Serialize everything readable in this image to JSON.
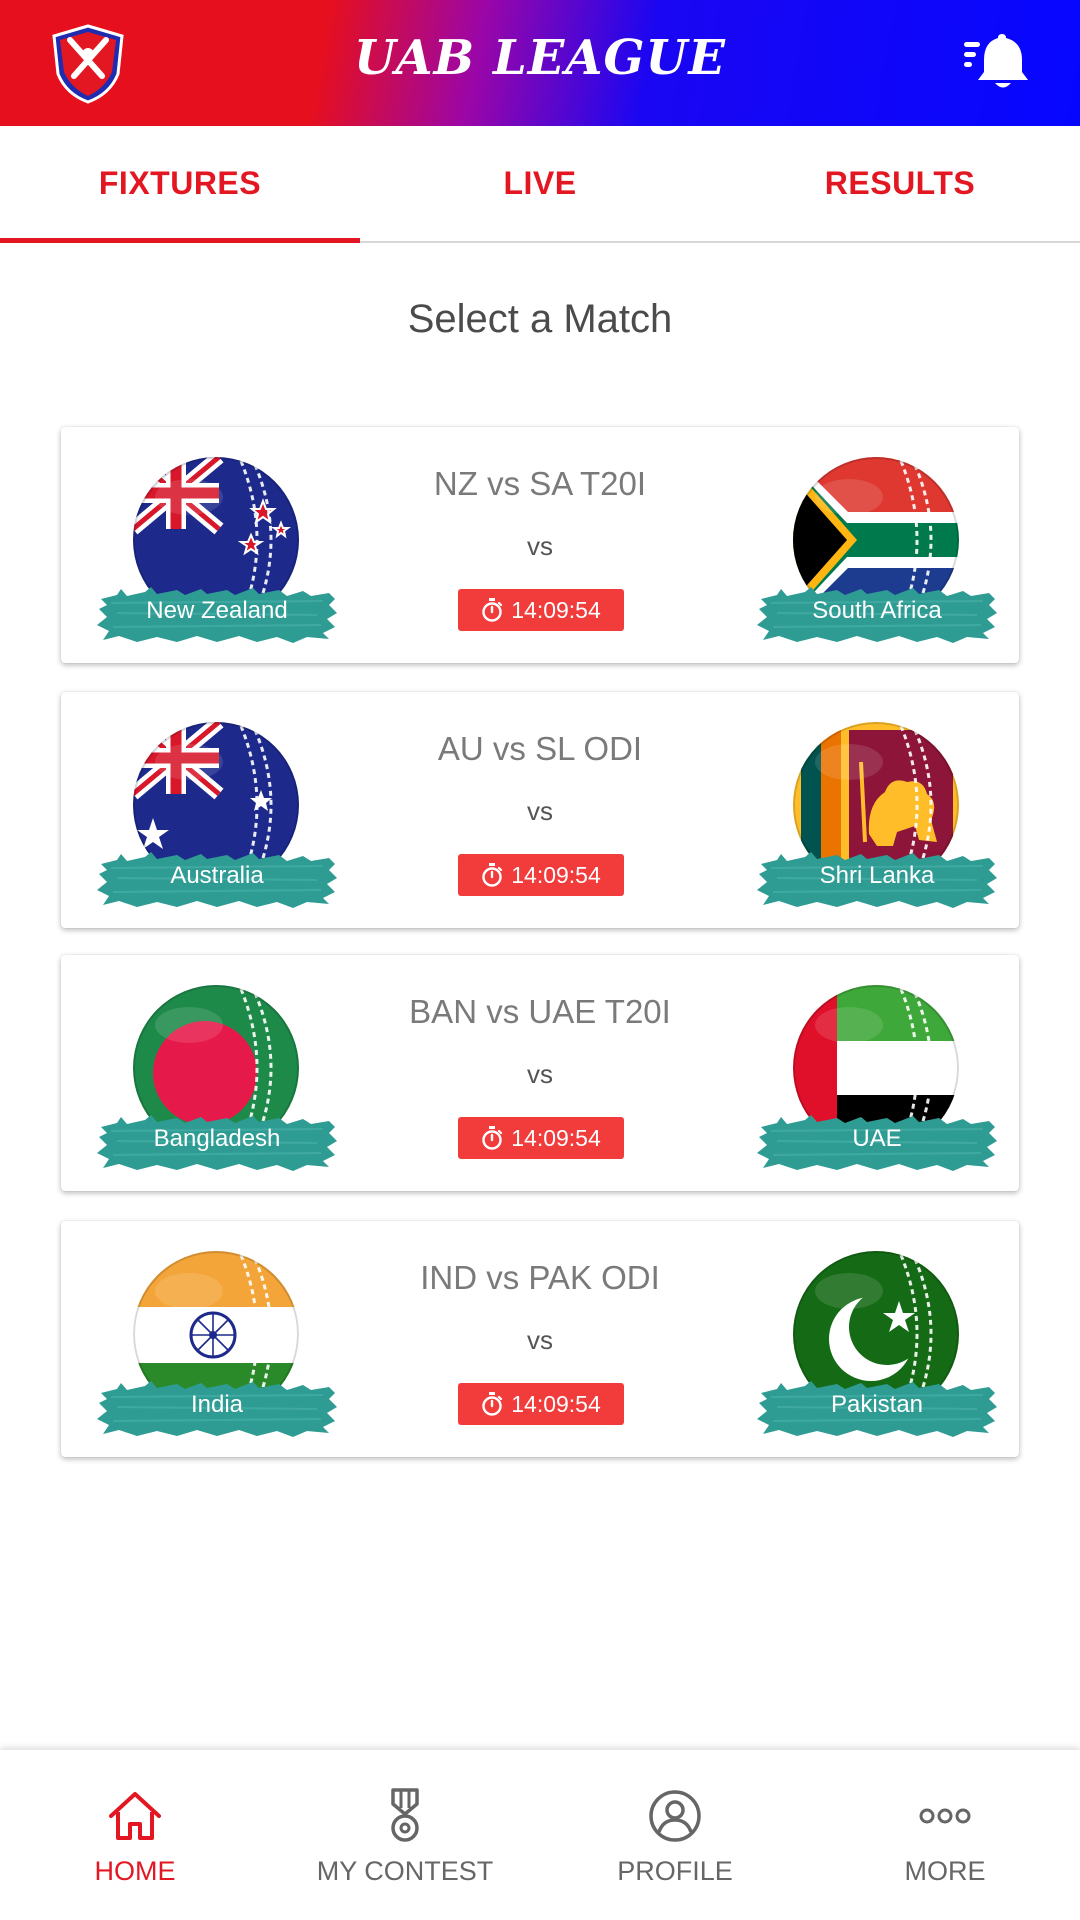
{
  "header": {
    "logo_text": "UAB LEAGUE",
    "title": "UAB LEAGUE",
    "icons": [
      "league-logo",
      "notification-bell-icon"
    ]
  },
  "tabs": [
    {
      "label": "FIXTURES",
      "active": true
    },
    {
      "label": "LIVE",
      "active": false
    },
    {
      "label": "RESULTS",
      "active": false
    }
  ],
  "section_title": "Select a Match",
  "matches": [
    {
      "title": "NZ vs SA T20I",
      "vs": "vs",
      "time": "14:09:54",
      "team1": "New Zealand",
      "team2": "South Africa"
    },
    {
      "title": "AU vs SL ODI",
      "vs": "vs",
      "time": "14:09:54",
      "team1": "Australia",
      "team2": "Shri Lanka"
    },
    {
      "title": "BAN vs UAE T20I",
      "vs": "vs",
      "time": "14:09:54",
      "team1": "Bangladesh",
      "team2": "UAE"
    },
    {
      "title": "IND vs PAK ODI",
      "vs": "vs",
      "time": "14:09:54",
      "team1": "India",
      "team2": "Pakistan"
    }
  ],
  "bottom_nav": [
    {
      "label": "HOME",
      "icon": "home-icon",
      "active": true
    },
    {
      "label": "MY CONTEST",
      "icon": "medal-icon",
      "active": false
    },
    {
      "label": "PROFILE",
      "icon": "user-icon",
      "active": false
    },
    {
      "label": "MORE",
      "icon": "more-icon",
      "active": false
    }
  ],
  "colors": {
    "accent": "#e31722",
    "header_red": "#e60f1e",
    "header_blue": "#0606ff",
    "timer_bg": "#f23b3b",
    "brush": "#2f9c94"
  }
}
